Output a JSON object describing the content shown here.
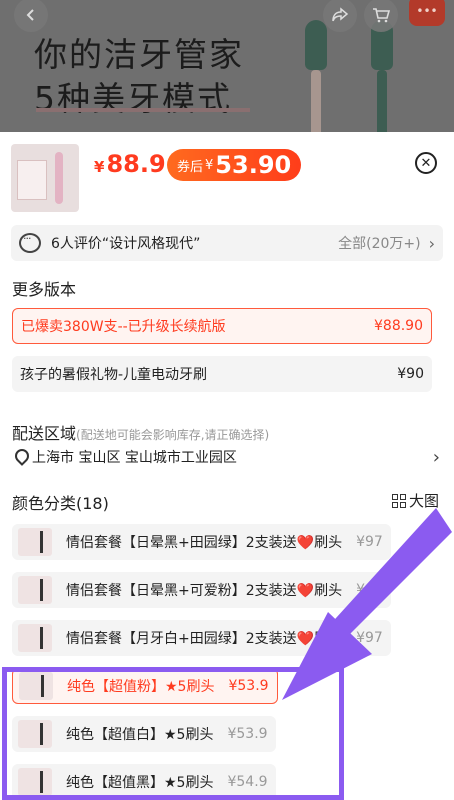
{
  "banner": {
    "line1": "你的洁牙管家",
    "line2": "5种美牙模式",
    "icons": [
      "back-icon",
      "share-icon",
      "cart-icon",
      "more-icon"
    ]
  },
  "product": {
    "price_symbol": "¥",
    "price": "88.9",
    "coupon_label": "券后",
    "coupon_symbol": "¥",
    "coupon_price": "53.90",
    "accent_color": "#ff3b1f"
  },
  "reviews": {
    "text": "6人评价“设计风格现代”",
    "all_label": "全部(20万+)"
  },
  "versions": {
    "title": "更多版本",
    "items": [
      {
        "label": "已爆卖380W支--已升级长续航版",
        "price": "¥88.90",
        "selected": true
      },
      {
        "label": "孩子的暑假礼物-儿童电动牙刷",
        "price": "¥90",
        "selected": false
      }
    ]
  },
  "delivery": {
    "title": "配送区域",
    "hint": "(配送地可能会影响库存,请正确选择)",
    "address": "上海市 宝山区 宝山城市工业园区"
  },
  "colors": {
    "title": "颜色分类(18)",
    "big_pic_label": "大图",
    "items": [
      {
        "pre": "情侣套餐【日晕黑+田园绿】2支装送",
        "post": "刷头",
        "heart": "❤️",
        "price": "¥97"
      },
      {
        "pre": "情侣套餐【日晕黑+可爱粉】2支装送",
        "post": "刷头",
        "heart": "❤️",
        "price": "¥97"
      },
      {
        "pre": "情侣套餐【月牙白+田园绿】2支装送",
        "post": "刷头",
        "heart": "❤️",
        "price": "¥97"
      },
      {
        "pre": "纯色【超值粉】★5刷头",
        "post": "",
        "heart": "",
        "price": "¥53.9",
        "selected": true
      },
      {
        "pre": "纯色【超值白】★5刷头",
        "post": "",
        "heart": "",
        "price": "¥53.9"
      },
      {
        "pre": "纯色【超值黑】★5刷头",
        "post": "",
        "heart": "",
        "price": "¥54.9"
      }
    ]
  },
  "annotation_color": "#8b5bf0"
}
